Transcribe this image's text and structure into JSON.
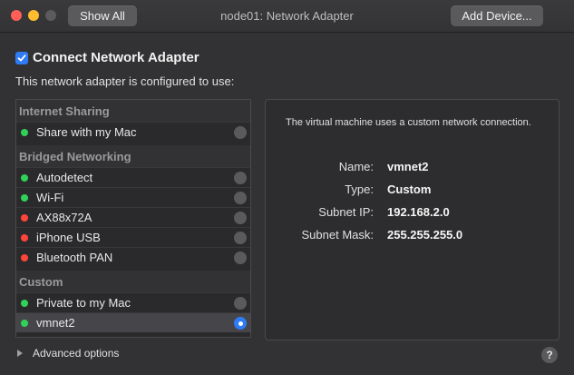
{
  "window": {
    "title": "node01: Network Adapter",
    "show_all_label": "Show All",
    "add_device_label": "Add Device..."
  },
  "connect": {
    "label": "Connect Network Adapter",
    "checked": true,
    "subtitle": "This network adapter is configured to use:"
  },
  "groups": [
    {
      "header": "Internet Sharing",
      "items": [
        {
          "label": "Share with my Mac",
          "status": "green",
          "selected": false
        }
      ]
    },
    {
      "header": "Bridged Networking",
      "items": [
        {
          "label": "Autodetect",
          "status": "green",
          "selected": false
        },
        {
          "label": "Wi-Fi",
          "status": "green",
          "selected": false
        },
        {
          "label": "AX88x72A",
          "status": "red",
          "selected": false
        },
        {
          "label": "iPhone USB",
          "status": "red",
          "selected": false
        },
        {
          "label": "Bluetooth PAN",
          "status": "red",
          "selected": false
        }
      ]
    },
    {
      "header": "Custom",
      "items": [
        {
          "label": "Private to my Mac",
          "status": "green",
          "selected": false
        },
        {
          "label": "vmnet2",
          "status": "green",
          "selected": true
        }
      ]
    }
  ],
  "details": {
    "description": "The virtual machine uses a custom network connection.",
    "name_label": "Name:",
    "name_value": "vmnet2",
    "type_label": "Type:",
    "type_value": "Custom",
    "subnet_ip_label": "Subnet IP:",
    "subnet_ip_value": "192.168.2.0",
    "subnet_mask_label": "Subnet Mask:",
    "subnet_mask_value": "255.255.255.0"
  },
  "footer": {
    "advanced_label": "Advanced options",
    "help_label": "?"
  },
  "colors": {
    "accent": "#2f7bf5",
    "status_green": "#30d158",
    "status_red": "#ff453a"
  }
}
